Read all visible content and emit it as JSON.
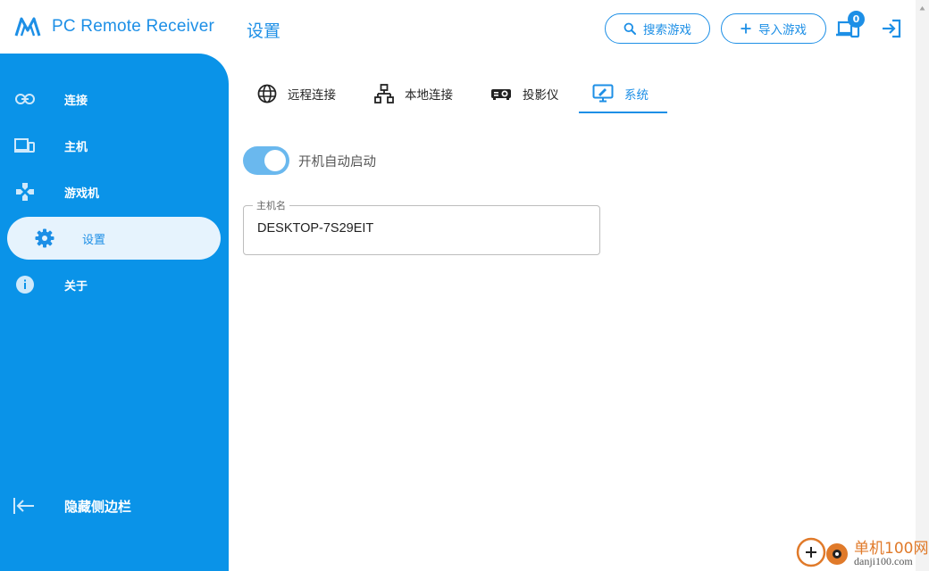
{
  "header": {
    "app_title": "PC Remote Receiver",
    "page_title": "设置",
    "search_label": "搜索游戏",
    "import_label": "导入游戏",
    "device_badge": "0",
    "icons": {
      "logo": "logo-icon",
      "search": "search-icon",
      "add": "plus-icon",
      "devices": "devices-icon",
      "login": "login-icon"
    }
  },
  "sidebar": {
    "items": [
      {
        "label": "连接",
        "icon": "link-icon"
      },
      {
        "label": "主机",
        "icon": "computer-icon"
      },
      {
        "label": "游戏机",
        "icon": "gamepad-icon"
      },
      {
        "label": "设置",
        "icon": "gear-icon",
        "active": true
      },
      {
        "label": "关于",
        "icon": "info-icon"
      }
    ],
    "hide_label": "隐藏侧边栏"
  },
  "tabs": [
    {
      "label": "远程连接",
      "icon": "globe-icon"
    },
    {
      "label": "本地连接",
      "icon": "network-icon"
    },
    {
      "label": "投影仪",
      "icon": "projector-icon"
    },
    {
      "label": "系统",
      "icon": "monitor-icon",
      "active": true
    }
  ],
  "settings": {
    "autostart_label": "开机自动启动",
    "autostart_on": true,
    "hostname_label": "主机名",
    "hostname_value": "DESKTOP-7S29EIT"
  },
  "watermark": {
    "cn": "单机100网",
    "url": "danji100.com"
  },
  "colors": {
    "accent": "#1d8fe6",
    "sidebar": "#0a93e8",
    "active_item_bg": "#e6f3fd",
    "toggle_track": "#6ab8ee"
  }
}
